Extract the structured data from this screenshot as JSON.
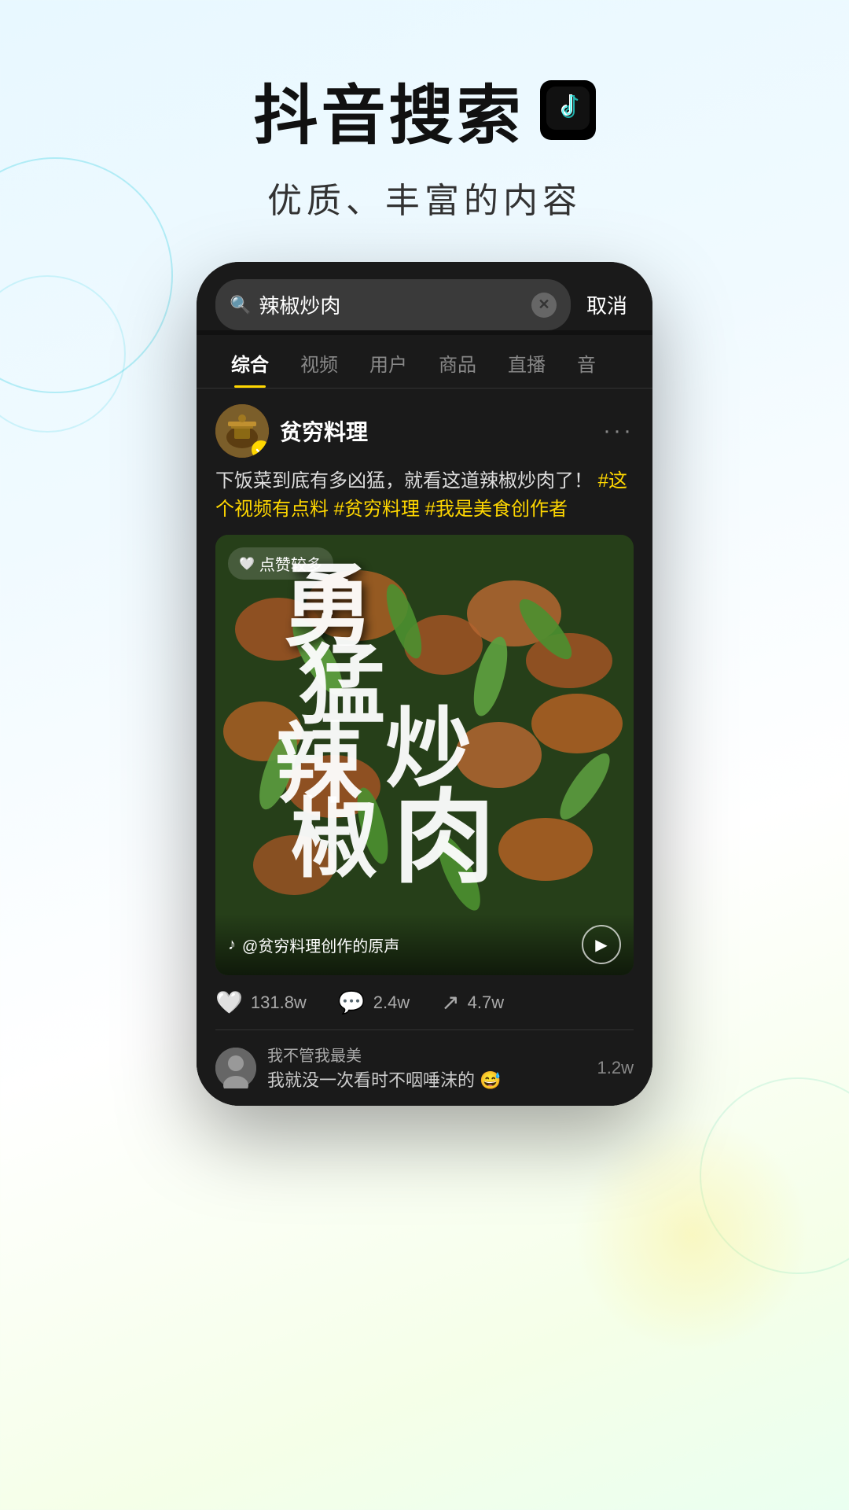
{
  "header": {
    "main_title": "抖音搜索",
    "subtitle": "优质、丰富的内容"
  },
  "phone": {
    "search": {
      "query": "辣椒炒肉",
      "cancel_label": "取消"
    },
    "tabs": [
      {
        "id": "comprehensive",
        "label": "综合",
        "active": true
      },
      {
        "id": "video",
        "label": "视频",
        "active": false
      },
      {
        "id": "user",
        "label": "用户",
        "active": false
      },
      {
        "id": "product",
        "label": "商品",
        "active": false
      },
      {
        "id": "live",
        "label": "直播",
        "active": false
      },
      {
        "id": "audio",
        "label": "音",
        "active": false
      }
    ],
    "post": {
      "username": "贫穷料理",
      "verified": true,
      "description_normal": "下饭菜到底有多凶猛，就看这道辣椒炒肉了！",
      "description_tags": "#这个视频有点料 #贫穷料理 #我是美食创作者",
      "likes_badge": "点赞较多",
      "video_text": "勇\n猛\n辣\n椒\n炒\n肉",
      "audio_credit": "@贫穷料理创作的原声",
      "interactions": {
        "likes": "131.8w",
        "comments": "2.4w",
        "shares": "4.7w"
      },
      "comment_user": "我不管我最美",
      "comment_text": "我就没一次看时不咽唾沫的 😅",
      "comment_count": "1.2w"
    }
  }
}
